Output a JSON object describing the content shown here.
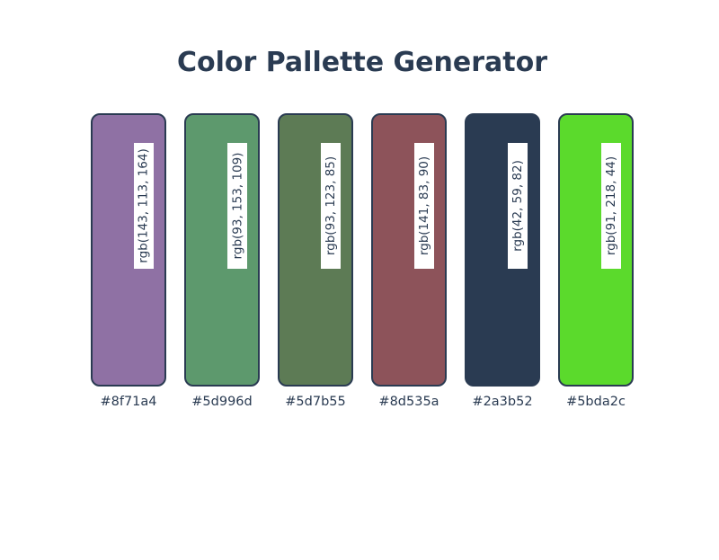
{
  "header": {
    "title": "Color Pallette Generator"
  },
  "palette": {
    "swatches": [
      {
        "hex": "#8f71a4",
        "rgb": "rgb(143, 113, 164)",
        "color": "#8f71a4"
      },
      {
        "hex": "#5d996d",
        "rgb": "rgb(93, 153, 109)",
        "color": "#5d996d"
      },
      {
        "hex": "#5d7b55",
        "rgb": "rgb(93, 123, 85)",
        "color": "#5d7b55"
      },
      {
        "hex": "#8d535a",
        "rgb": "rgb(141, 83, 90)",
        "color": "#8d535a"
      },
      {
        "hex": "#2a3b52",
        "rgb": "rgb(42, 59, 82)",
        "color": "#2a3b52"
      },
      {
        "hex": "#5bda2c",
        "rgb": "rgb(91, 218, 44)",
        "color": "#5bda2c"
      }
    ]
  },
  "theme": {
    "text_color": "#2a3b52",
    "border_color": "#2a3b52",
    "background": "#ffffff"
  }
}
